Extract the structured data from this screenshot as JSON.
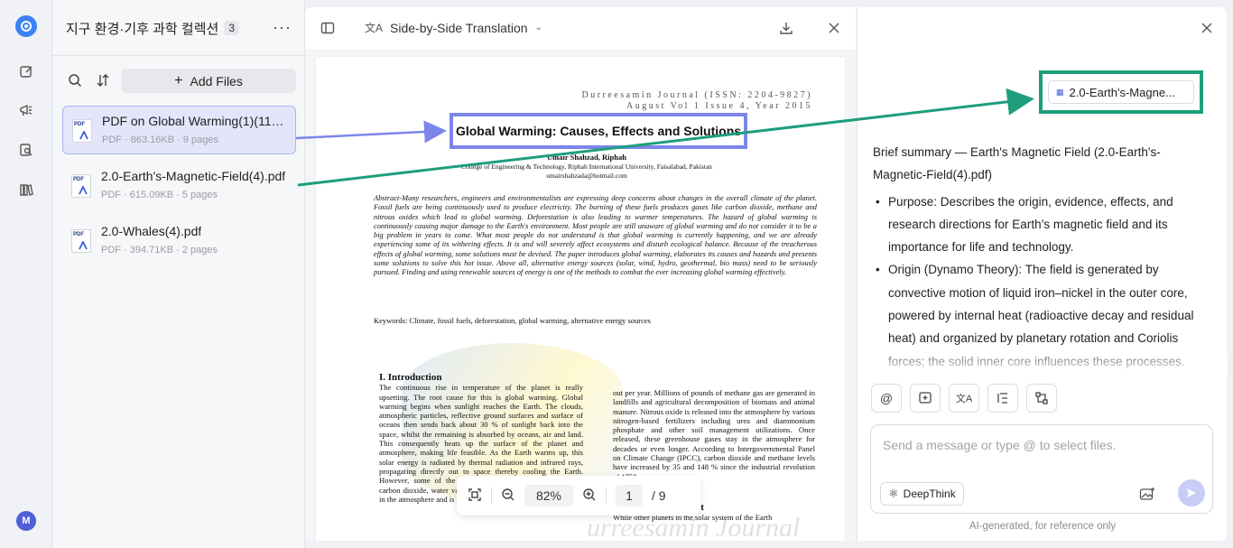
{
  "collection": {
    "title": "지구 환경·기후 과학 컬렉션",
    "count": "3"
  },
  "toolbar": {
    "add_files_label": "Add Files"
  },
  "files": [
    {
      "name": "PDF on Global Warming(1)(11).pdf",
      "meta": "PDF · 863.16KB · 9 pages",
      "selected": true
    },
    {
      "name": "2.0-Earth's-Magnetic-Field(4).pdf",
      "meta": "PDF · 615.09KB · 5 pages",
      "selected": false
    },
    {
      "name": "2.0-Whales(4).pdf",
      "meta": "PDF · 394.71KB · 2 pages",
      "selected": false
    }
  ],
  "viewer": {
    "mode_label": "Side-by-Side Translation",
    "zoom": "82%",
    "page_current": "1",
    "page_total": "/ 9"
  },
  "document": {
    "journal_line1": "Durreesamin Journal (ISSN: 2204-9827)",
    "journal_line2": "August Vol 1 Issue 4, Year 2015",
    "title": "Global Warming: Causes, Effects and Solutions",
    "authors": "Umair Shahzad, Riphah",
    "affiliation": "College of Engineering & Technology, Riphah International University, Faisalabad, Pakistan",
    "email": "umairshahzada@hotmail.com",
    "abstract": "Abstract-Many researchers, engineers and environmentalists are expressing deep concerns about changes in the overall climate of the planet. Fossil fuels are being continuously used to produce electricity. The burning of these fuels produces gases like carbon dioxide, methane and nitrous oxides which lead to global warming. Deforestation is also leading to warmer temperatures. The hazard of global warming is continuously causing major damage to the Earth's environment. Most people are still unaware of global warming and do not consider it to be a big problem in years to come. What most people do not understand is that global warming is currently happening, and we are already experiencing some of its withering effects. It is and will severely affect ecosystems and disturb ecological balance. Because of the treacherous effects of global warming, some solutions must be devised. The paper introduces global warming, elaborates its causes and hazards and presents some solutions to solve this hot issue. Above all, alternative energy sources (solar, wind, hydro, geothermal, bio mass) need to be seriously pursued. Finding and using renewable sources of energy is one of the methods to combat the ever increasing global warming effectively.",
    "keywords": "Keywords: Climate, fossil fuels, deforestation, global warming, alternative energy sources",
    "intro_heading": "I. Introduction",
    "intro_text": "The continuous rise in temperature of the planet is really upsetting. The root cause for this is global warming. Global warming begins when sunlight reaches the Earth. The clouds, atmospheric particles, reflective ground surfaces and surface of oceans then sends back about 30 % of sunlight back into the space, whilst the remaining is absorbed by oceans, air and land. This consequently heats up the surface of the planet and atmosphere, making life feasible. As the Earth warms up, this solar energy is radiated by thermal radiation and infrared rays, propagating directly out to space thereby cooling the Earth. However, some of the outgoing radiation is re-absorbed by carbon dioxide, water vapours, ozone, methane and other gases in the atmosphere and is radiated back to the surface of Earth.",
    "right_text": "out per year. Millions of pounds of methane gas are generated in landfills and agricultural decomposition of biomass and animal manure. Nitrous oxide is released into the atmosphere by various nitrogen-based fertilizers including urea and diammonium phosphate and other soil management utilizations. Once released, these greenhouse gases stay in the atmosphere for decades or even longer. According to Intergovernmental Panel on Climate Change (IPCC), carbon dioxide and methane levels have increased by 35 and 148 % since the industrial revolution of 1750.",
    "section2_heading": "II. Greenhouse Effect",
    "section2_text": "While other planets in the solar system of the Earth",
    "watermark": "urreesamin Journal"
  },
  "chat": {
    "file_chip": "2.0-Earth's-Magne...",
    "summary_intro": "Brief summary — Earth's Magnetic Field (2.0-Earth's-Magnetic-Field(4).pdf)",
    "bullets": [
      "Purpose: Describes the origin, evidence, effects, and research directions for Earth’s magnetic field and its importance for life and technology.",
      "Origin (Dynamo Theory): The field is generated by convective motion of liquid iron–nickel in the outer core, powered by internal heat (radioactive decay and residual heat) and organized by planetary rotation and Coriolis forces; the solid inner core influences these processes."
    ],
    "input_placeholder": "Send a message or type @ to select files.",
    "deepthink_label": "DeepThink",
    "footnote": "AI-generated, for reference only"
  },
  "user": {
    "avatar_initial": "M"
  },
  "colors": {
    "accent": "#4f5fd6",
    "highlight_blue": "#7b86e8",
    "highlight_green": "#1e9e7c"
  }
}
